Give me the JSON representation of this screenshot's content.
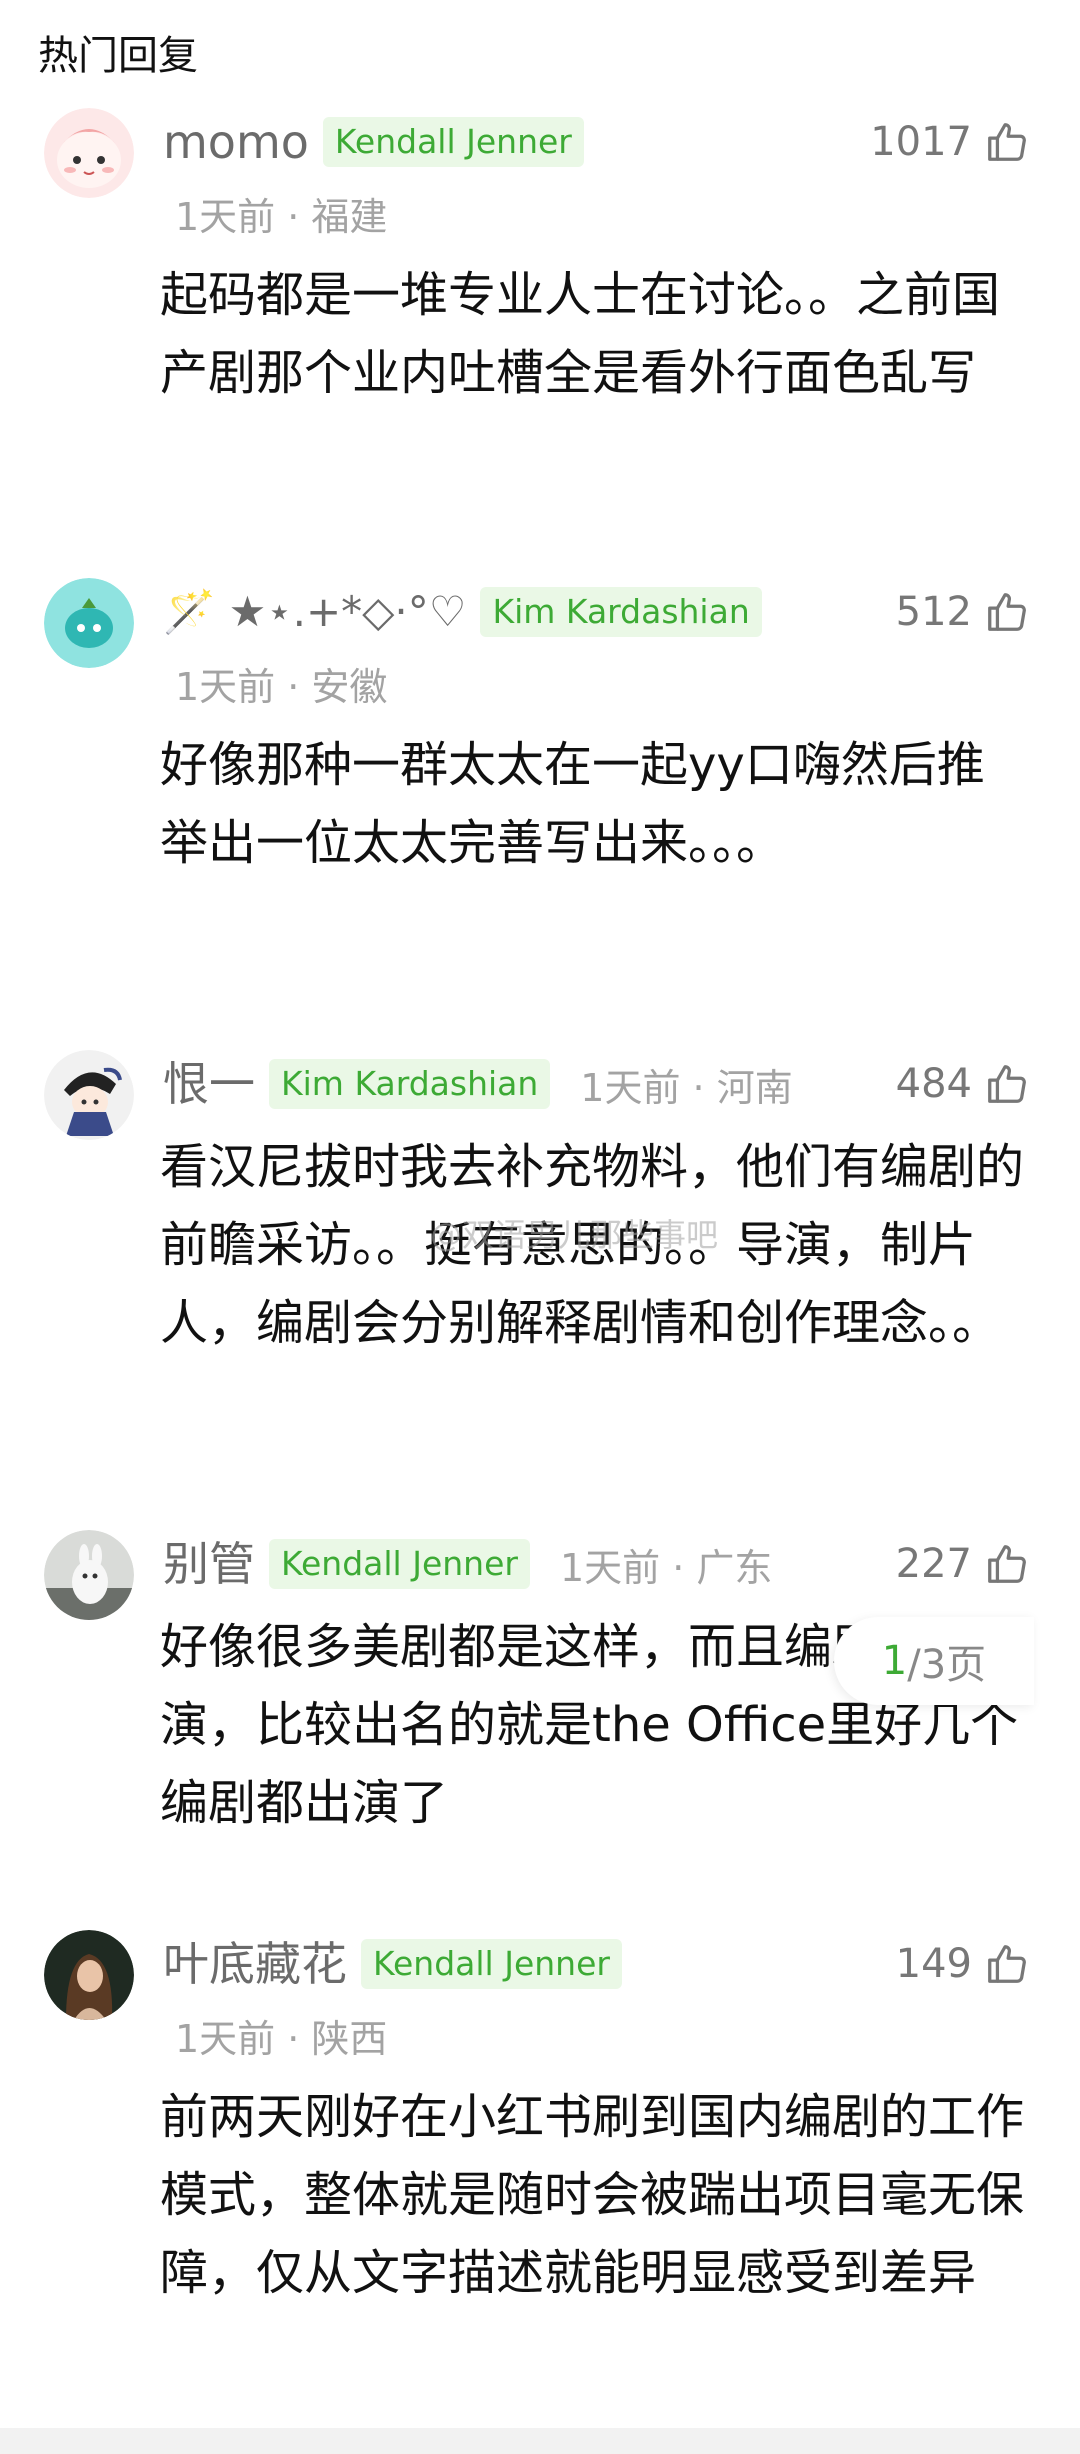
{
  "section_title": "热门回复",
  "watermark": "@双语男儿那些事吧",
  "page_indicator": {
    "current": "1",
    "rest": "/3页"
  },
  "colors": {
    "tag_bg": "#eaf8e6",
    "tag_text": "#3daa35",
    "meta": "#a3a3a3"
  },
  "comments": [
    {
      "username": "momo",
      "tag": "Kendall Jenner",
      "time": "1天前",
      "location": "福建",
      "meta": "1天前 · 福建",
      "likes": "1017",
      "avatar_icon": "pink-cartoon-avatar",
      "text": "起码都是一堆专业人士在讨论。。之前国产剧那个业内吐槽全是看外行面色乱写"
    },
    {
      "username": "🪄 ★⋆.+*◇·°♡",
      "tag": "Kim Kardashian",
      "time": "1天前",
      "location": "安徽",
      "meta": "1天前 · 安徽",
      "likes": "512",
      "avatar_icon": "teal-creature-avatar",
      "text": "好像那种一群太太在一起yy口嗨然后推举出一位太太完善写出来。。。"
    },
    {
      "username": "恨一",
      "tag": "Kim Kardashian",
      "time": "1天前",
      "location": "河南",
      "meta": "1天前 · 河南",
      "likes": "484",
      "avatar_icon": "anime-character-avatar",
      "text": "看汉尼拔时我去补充物料，他们有编剧的前瞻采访。。挺有意思的。。导演，制片人，编剧会分别解释剧情和创作理念。。"
    },
    {
      "username": "别管",
      "tag": "Kendall Jenner",
      "time": "1天前",
      "location": "广东",
      "meta": "1天前 · 广东",
      "likes": "227",
      "avatar_icon": "white-animal-avatar",
      "text": "好像很多美剧都是这样，而且编剧也会出演，比较出名的就是the Office里好几个编剧都出演了"
    },
    {
      "username": "叶底藏花",
      "tag": "Kendall Jenner",
      "time": "1天前",
      "location": "陕西",
      "meta": "1天前 · 陕西",
      "likes": "149",
      "avatar_icon": "portrait-photo-avatar",
      "text": "前两天刚好在小红书刷到国内编剧的工作模式，整体就是随时会被踹出项目毫无保障，仅从文字描述就能明显感受到差异"
    }
  ]
}
